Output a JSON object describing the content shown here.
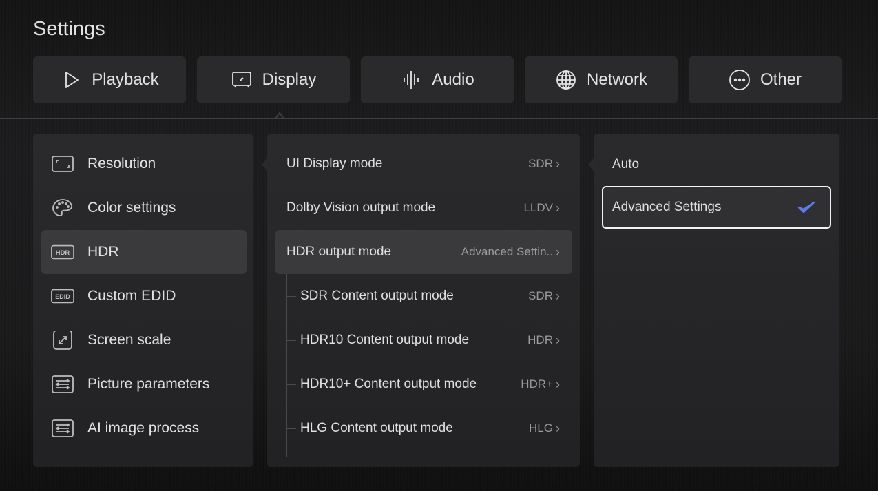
{
  "header": {
    "title": "Settings"
  },
  "tabs": [
    {
      "label": "Playback",
      "icon": "play-icon"
    },
    {
      "label": "Display",
      "icon": "tv-icon",
      "active": true
    },
    {
      "label": "Audio",
      "icon": "audio-wave-icon"
    },
    {
      "label": "Network",
      "icon": "globe-icon"
    },
    {
      "label": "Other",
      "icon": "more-circle-icon"
    }
  ],
  "display_menu": [
    {
      "label": "Resolution",
      "icon": "resolution-frame-icon"
    },
    {
      "label": "Color settings",
      "icon": "palette-icon"
    },
    {
      "label": "HDR",
      "icon": "hdr-badge-icon",
      "icon_text": "HDR",
      "active": true
    },
    {
      "label": "Custom EDID",
      "icon": "edid-badge-icon",
      "icon_text": "EDID"
    },
    {
      "label": "Screen scale",
      "icon": "expand-icon"
    },
    {
      "label": "Picture parameters",
      "icon": "sliders-icon"
    },
    {
      "label": "AI image process",
      "icon": "sliders-icon"
    }
  ],
  "hdr_settings": [
    {
      "label": "UI Display mode",
      "value": "SDR"
    },
    {
      "label": "Dolby Vision output mode",
      "value": "LLDV"
    },
    {
      "label": "HDR output mode",
      "value": "Advanced Settin..",
      "active": true
    },
    {
      "label": "SDR Content output mode",
      "value": "SDR",
      "sub": true
    },
    {
      "label": "HDR10 Content output mode",
      "value": "HDR",
      "sub": true
    },
    {
      "label": "HDR10+ Content output mode",
      "value": "HDR+",
      "sub": true
    },
    {
      "label": "HLG Content output mode",
      "value": "HLG",
      "sub": true
    }
  ],
  "hdr_output_options": [
    {
      "label": "Auto",
      "selected": false
    },
    {
      "label": "Advanced Settings",
      "selected": true
    }
  ],
  "chevron": "›",
  "colors": {
    "check_accent": "#5b7cf0",
    "selection_border": "#f2f2f2"
  }
}
